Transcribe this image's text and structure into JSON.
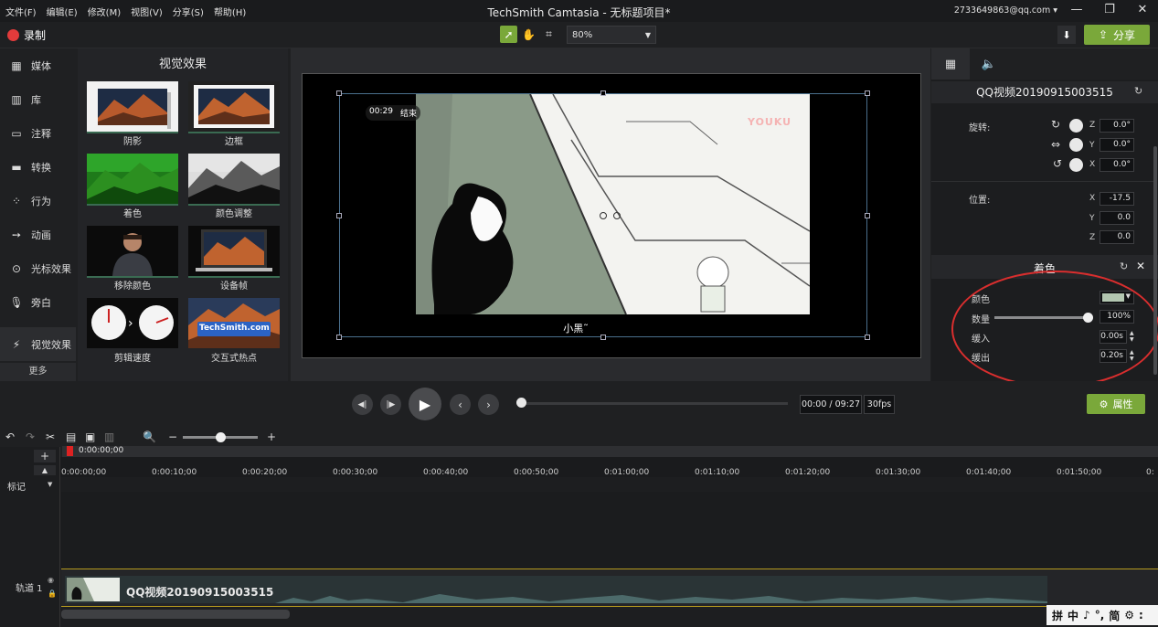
{
  "menubar": {
    "menus": [
      "文件(F)",
      "编辑(E)",
      "修改(M)",
      "视图(V)",
      "分享(S)",
      "帮助(H)"
    ],
    "title": "TechSmith Camtasia - 无标题项目*",
    "account": "2733649863@qq.com ▾",
    "window_buttons": [
      "—",
      "❐",
      "✕"
    ]
  },
  "toolbar": {
    "record_label": "录制",
    "zoom_value": "80%",
    "share_label": "分享"
  },
  "leftnav": {
    "items": [
      {
        "label": "媒体",
        "icon": "film-icon"
      },
      {
        "label": "库",
        "icon": "library-icon"
      },
      {
        "label": "注释",
        "icon": "annotation-icon"
      },
      {
        "label": "转换",
        "icon": "transition-icon"
      },
      {
        "label": "行为",
        "icon": "behavior-icon"
      },
      {
        "label": "动画",
        "icon": "animation-icon"
      },
      {
        "label": "光标效果",
        "icon": "cursor-icon"
      },
      {
        "label": "旁白",
        "icon": "microphone-icon"
      },
      {
        "label": "视觉效果",
        "icon": "magic-wand-icon"
      }
    ],
    "more_label": "更多"
  },
  "effects": {
    "title": "视觉效果",
    "tiles": [
      "阴影",
      "边框",
      "着色",
      "颜色调整",
      "移除颜色",
      "设备帧",
      "剪辑速度",
      "交互式热点"
    ],
    "hotspot_thumb_text": "TechSmith.com"
  },
  "preview": {
    "time_badge": "00:29",
    "end_badge": "结束",
    "subtitle": "小黑˜",
    "watermark": "YOUKU"
  },
  "properties": {
    "clip_name": "QQ视频20190915003515",
    "rotation_label": "旋转:",
    "rotation": {
      "z": "0.0°",
      "y": "0.0°",
      "x": "0.0°"
    },
    "position_label": "位置:",
    "position": {
      "x": "-17.5",
      "y": "0.0",
      "z": "0.0"
    },
    "axis_labels": {
      "x": "X",
      "y": "Y",
      "z": "Z"
    },
    "tint_section": "着色",
    "color_label": "颜色",
    "color_value": "#b3c7b1",
    "amount_label": "数量",
    "amount_value": "100%",
    "fadein_label": "缓入",
    "fadein_value": "0.00s",
    "fadeout_label": "缓出",
    "fadeout_value": "0.20s"
  },
  "transport": {
    "time": "00:00 / 09:27",
    "fps": "30fps",
    "properties_label": "属性"
  },
  "timeline": {
    "playhead_time": "0:00:00;00",
    "ticks": [
      "0:00:00;00",
      "0:00:10;00",
      "0:00:20;00",
      "0:00:30;00",
      "0:00:40;00",
      "0:00:50;00",
      "0:01:00;00",
      "0:01:10;00",
      "0:01:20;00",
      "0:01:30;00",
      "0:01:40;00",
      "0:01:50;00",
      "0:"
    ],
    "marker_label": "标记",
    "track_label": "轨道 1",
    "clip_name": "QQ视频20190915003515"
  },
  "ime": [
    "拼",
    "中",
    "♪",
    "°,",
    "简",
    "⚙",
    ":"
  ],
  "colors": {
    "accent": "#7aa83a",
    "annotation_red": "#d92e2e",
    "track_border": "#b59a1e"
  }
}
